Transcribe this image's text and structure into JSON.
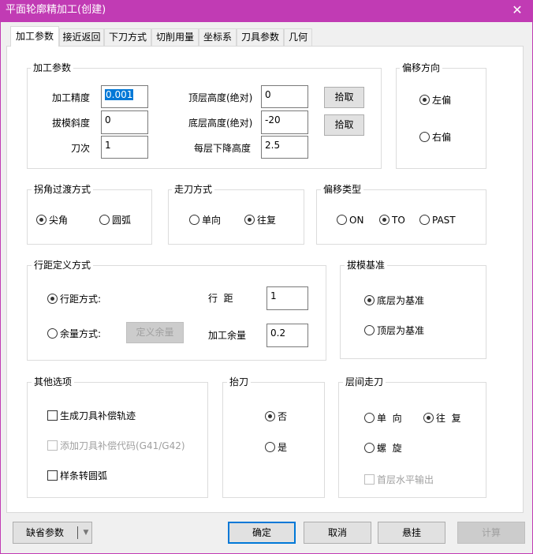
{
  "window": {
    "title": "平面轮廓精加工(创建)",
    "close": "✕"
  },
  "tabs": [
    "加工参数",
    "接近返回",
    "下刀方式",
    "切削用量",
    "坐标系",
    "刀具参数",
    "几何"
  ],
  "machining": {
    "title": "加工参数",
    "precision_label": "加工精度",
    "precision": "0.001",
    "draft_label": "拔模斜度",
    "draft": "0",
    "passes_label": "刀次",
    "passes": "1",
    "top_label": "顶层高度(绝对)",
    "top": "0",
    "bottom_label": "底层高度(绝对)",
    "bottom": "-20",
    "step_label": "每层下降高度",
    "step": "2.5",
    "pick1": "拾取",
    "pick2": "拾取"
  },
  "offset_dir": {
    "title": "偏移方向",
    "left": "左偏",
    "right": "右偏"
  },
  "corner": {
    "title": "拐角过渡方式",
    "sharp": "尖角",
    "arc": "圆弧"
  },
  "cut_mode": {
    "title": "走刀方式",
    "one_way": "单向",
    "zigzag": "往复"
  },
  "offset_type": {
    "title": "偏移类型",
    "on": "ON",
    "to": "TO",
    "past": "PAST"
  },
  "stepover": {
    "title": "行距定义方式",
    "by_step": "行距方式:",
    "by_allowance": "余量方式:",
    "define_allowance": "定义余量",
    "step_label": "行  距",
    "step": "1",
    "allowance_label": "加工余量",
    "allowance": "0.2"
  },
  "draft_base": {
    "title": "拔模基准",
    "bottom": "底层为基准",
    "top": "顶层为基准"
  },
  "other": {
    "title": "其他选项",
    "gen_comp": "生成刀具补偿轨迹",
    "add_code": "添加刀具补偿代码(G41/G42)",
    "spline_arc": "样条转圆弧"
  },
  "lift": {
    "title": "抬刀",
    "no": "否",
    "yes": "是"
  },
  "layer": {
    "title": "层间走刀",
    "one_way": "单  向",
    "zigzag": "往  复",
    "spiral": "螺  旋",
    "first_horiz": "首层水平输出"
  },
  "footer": {
    "defaults": "缺省参数",
    "ok": "确定",
    "cancel": "取消",
    "suspend": "悬挂",
    "compute": "计算"
  }
}
